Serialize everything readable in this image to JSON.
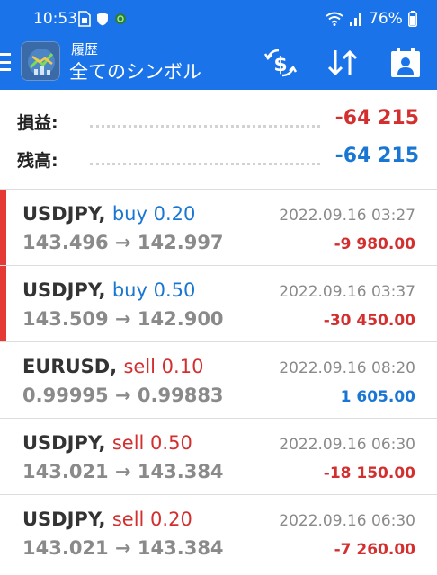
{
  "status_bar": {
    "time": "10:53",
    "battery": "76%"
  },
  "toolbar": {
    "subtitle": "履歴",
    "title": "全てのシンボル",
    "icons": [
      "menu-icon",
      "currency-exchange-icon",
      "sort-arrows-icon",
      "calendar-person-icon"
    ]
  },
  "summary": {
    "profit_label": "損益:",
    "profit_value": "-64 215",
    "balance_label": "残高:",
    "balance_value": "-64 215"
  },
  "colors": {
    "header_bg": "#1a73e8",
    "negative": "#d32f2f",
    "positive": "#1976d2",
    "buy": "#1976d2",
    "sell": "#d32f2f",
    "indicator": "#e53935"
  },
  "trades": [
    {
      "symbol": "USDJPY,",
      "side": "buy 0.20",
      "open": "143.496",
      "arrow": "→",
      "close": "142.997",
      "time": "2022.09.16 03:27",
      "profit": "-9 980.00",
      "indicator": true
    },
    {
      "symbol": "USDJPY,",
      "side": "buy 0.50",
      "open": "143.509",
      "arrow": "→",
      "close": "142.900",
      "time": "2022.09.16 03:37",
      "profit": "-30 450.00",
      "indicator": true
    },
    {
      "symbol": "EURUSD,",
      "side": "sell 0.10",
      "open": "0.99995",
      "arrow": "→",
      "close": "0.99883",
      "time": "2022.09.16 08:20",
      "profit": "1 605.00",
      "indicator": false
    },
    {
      "symbol": "USDJPY,",
      "side": "sell 0.50",
      "open": "143.021",
      "arrow": "→",
      "close": "143.384",
      "time": "2022.09.16 06:30",
      "profit": "-18 150.00",
      "indicator": false
    },
    {
      "symbol": "USDJPY,",
      "side": "sell 0.20",
      "open": "143.021",
      "arrow": "→",
      "close": "143.384",
      "time": "2022.09.16 06:30",
      "profit": "-7 260.00",
      "indicator": false
    }
  ]
}
